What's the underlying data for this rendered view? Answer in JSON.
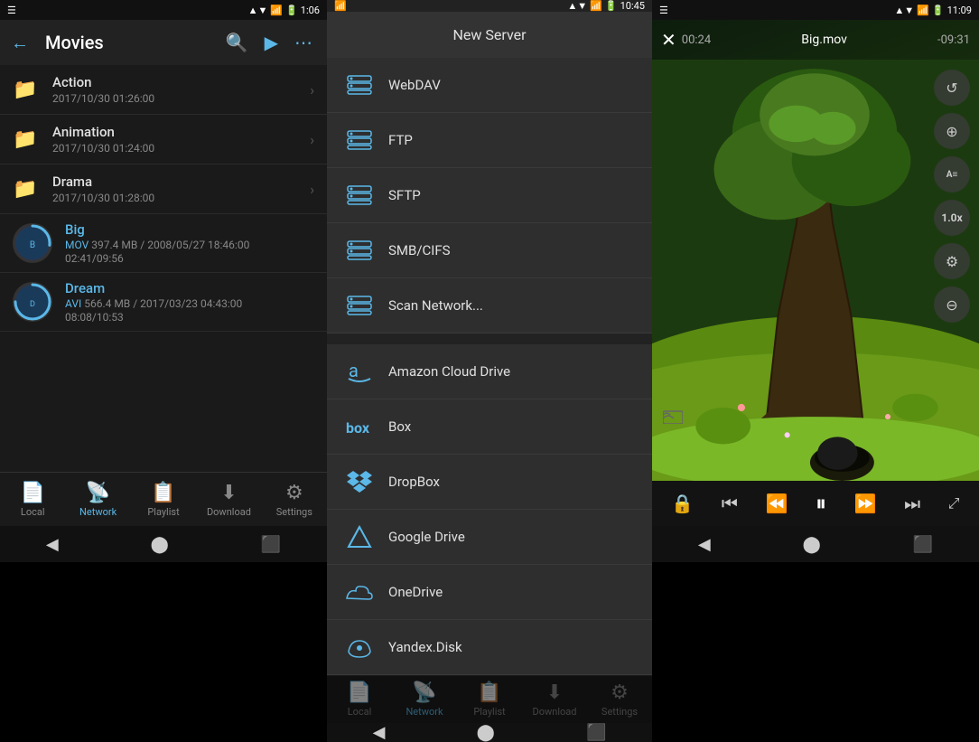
{
  "panel1": {
    "status": {
      "left": "📶",
      "time": "1:06",
      "icons": "▲▼📶🔋"
    },
    "toolbar": {
      "back_icon": "←",
      "title": "Movies",
      "search_icon": "🔍",
      "play_icon": "▶",
      "more_icon": "⋯"
    },
    "folders": [
      {
        "name": "Action",
        "meta": "2017/10/30 01:26:00"
      },
      {
        "name": "Animation",
        "meta": "2017/10/30 01:24:00"
      },
      {
        "name": "Drama",
        "meta": "2017/10/30 01:28:00"
      }
    ],
    "files": [
      {
        "name": "Big",
        "type_color": "blue",
        "type": "MOV",
        "size": "397.4 MB",
        "date": "2008/05/27 18:46:00",
        "duration": "02:41/09:56",
        "progress": 0.27
      },
      {
        "name": "Dream",
        "type_color": "blue",
        "type": "AVI",
        "size": "566.4 MB",
        "date": "2017/03/23 04:43:00",
        "duration": "08:08/10:53",
        "progress": 0.75
      }
    ],
    "bottom_nav": [
      {
        "icon": "📄",
        "label": "Local",
        "active": false
      },
      {
        "icon": "📡",
        "label": "Network",
        "active": true
      },
      {
        "icon": "📋",
        "label": "Playlist",
        "active": false
      },
      {
        "icon": "⬇",
        "label": "Download",
        "active": false
      },
      {
        "icon": "⚙",
        "label": "Settings",
        "active": false
      }
    ]
  },
  "panel2": {
    "status": {
      "time": "10:45"
    },
    "dialog_title": "New Server",
    "network_servers": [
      {
        "icon": "server",
        "label": "WebDAV"
      },
      {
        "icon": "server",
        "label": "FTP"
      },
      {
        "icon": "server",
        "label": "SFTP"
      },
      {
        "icon": "server",
        "label": "SMB/CIFS"
      },
      {
        "icon": "scan",
        "label": "Scan Network..."
      }
    ],
    "cloud_services": [
      {
        "icon": "amazon",
        "label": "Amazon Cloud Drive"
      },
      {
        "icon": "box",
        "label": "Box"
      },
      {
        "icon": "dropbox",
        "label": "DropBox"
      },
      {
        "icon": "gdrive",
        "label": "Google Drive"
      },
      {
        "icon": "onedrive",
        "label": "OneDrive"
      },
      {
        "icon": "yandex",
        "label": "Yandex.Disk"
      }
    ],
    "bottom_nav": [
      {
        "icon": "📄",
        "label": "Local",
        "active": false
      },
      {
        "icon": "📡",
        "label": "Network",
        "active": true
      },
      {
        "icon": "📋",
        "label": "Playlist",
        "active": false
      },
      {
        "icon": "⬇",
        "label": "Download",
        "active": false
      },
      {
        "icon": "⚙",
        "label": "Settings",
        "active": false
      }
    ]
  },
  "panel3": {
    "status": {
      "time": "11:09"
    },
    "video": {
      "filename": "Big.mov",
      "time_elapsed": "00:24",
      "time_remaining": "-09:31",
      "close_icon": "✕"
    },
    "controls_right": [
      {
        "id": "replay",
        "icon": "↺"
      },
      {
        "id": "zoom",
        "icon": "⊕"
      },
      {
        "id": "subtitle",
        "icon": "A="
      },
      {
        "id": "settings",
        "icon": "⚙"
      },
      {
        "id": "zoom-out",
        "icon": "⊖"
      }
    ],
    "speed_label": "1.0x",
    "bottom_controls": [
      {
        "id": "lock",
        "icon": "🔒"
      },
      {
        "id": "prev-chapter",
        "icon": "⏮"
      },
      {
        "id": "rewind",
        "icon": "⏪"
      },
      {
        "id": "pause",
        "icon": "⏸"
      },
      {
        "id": "forward",
        "icon": "⏩"
      },
      {
        "id": "next-chapter",
        "icon": "⏭"
      },
      {
        "id": "fullscreen",
        "icon": "⤢"
      }
    ]
  }
}
